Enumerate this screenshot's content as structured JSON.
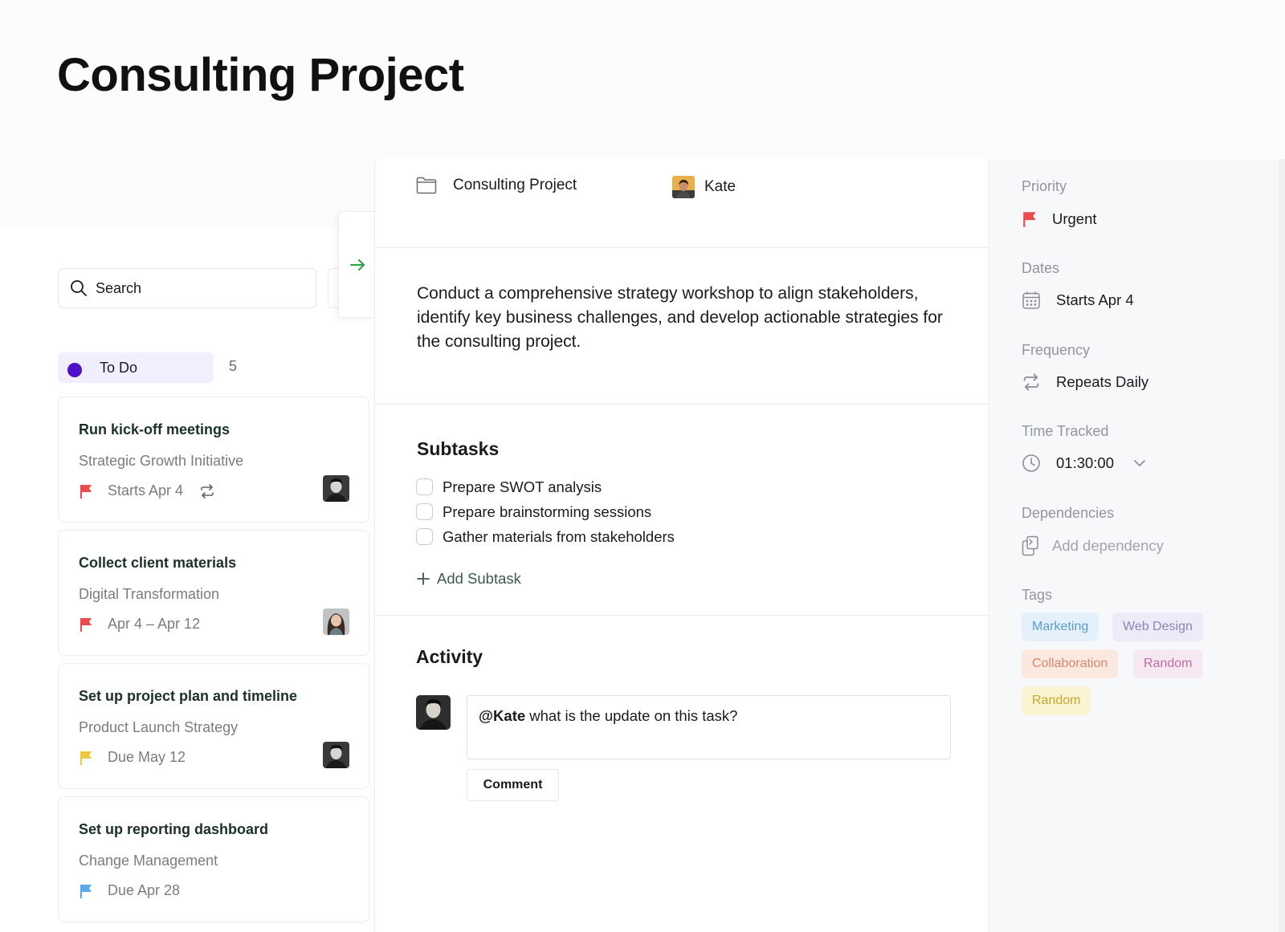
{
  "page": {
    "title": "Consulting Project"
  },
  "search": {
    "placeholder": "Search"
  },
  "status_group": {
    "label": "To Do",
    "count": "5",
    "dot_color": "#4f10c9"
  },
  "tasks": [
    {
      "title": "Run kick-off meetings",
      "project": "Strategic Growth Initiative",
      "date": "Starts Apr 4",
      "flag_color": "#ec4b4b",
      "repeats": true,
      "avatar": "man-portrait-avatar"
    },
    {
      "title": "Collect client materials",
      "project": "Digital Transformation",
      "date": "Apr 4 – Apr 12",
      "flag_color": "#ec4b4b",
      "repeats": false,
      "avatar": "woman-portrait-avatar"
    },
    {
      "title": "Set up project plan and timeline",
      "project": "Product Launch Strategy",
      "date": "Due May 12",
      "flag_color": "#f0c93c",
      "repeats": false,
      "avatar": "man-portrait-avatar"
    },
    {
      "title": "Set up reporting dashboard",
      "project": "Change Management",
      "date": "Due Apr 28",
      "flag_color": "#5aa9e8",
      "repeats": false,
      "avatar": ""
    }
  ],
  "detail": {
    "project_crumb": "Consulting Project",
    "assignee": "Kate",
    "description": "Conduct a comprehensive strategy workshop to align stakeholders, identify key business challenges, and develop actionable strategies for the consulting project.",
    "subtasks_heading": "Subtasks",
    "subtasks": [
      "Prepare SWOT analysis",
      "Prepare brainstorming sessions",
      "Gather materials from stakeholders"
    ],
    "add_subtask_label": "Add Subtask",
    "activity_heading": "Activity",
    "comment_mention": "@Kate",
    "comment_text": " what is the update on this task?",
    "comment_button": "Comment"
  },
  "properties": {
    "priority_label": "Priority",
    "priority_value": "Urgent",
    "priority_color": "#ec4b4b",
    "dates_label": "Dates",
    "dates_value": "Starts Apr 4",
    "frequency_label": "Frequency",
    "frequency_value": "Repeats Daily",
    "time_label": "Time Tracked",
    "time_value": "01:30:00",
    "dependencies_label": "Dependencies",
    "dependencies_value": "Add dependency",
    "tags_label": "Tags",
    "tags": [
      {
        "name": "Marketing",
        "bg": "#e4f1fb",
        "fg": "#5b9dd3"
      },
      {
        "name": "Web Design",
        "bg": "#ecebf7",
        "fg": "#8a86b8"
      },
      {
        "name": "Collaboration",
        "bg": "#fbe9e0",
        "fg": "#d9896a"
      },
      {
        "name": "Random",
        "bg": "#f6e8f1",
        "fg": "#c06ea6"
      },
      {
        "name": "Random",
        "bg": "#fbf4d2",
        "fg": "#c9a72a"
      }
    ]
  }
}
